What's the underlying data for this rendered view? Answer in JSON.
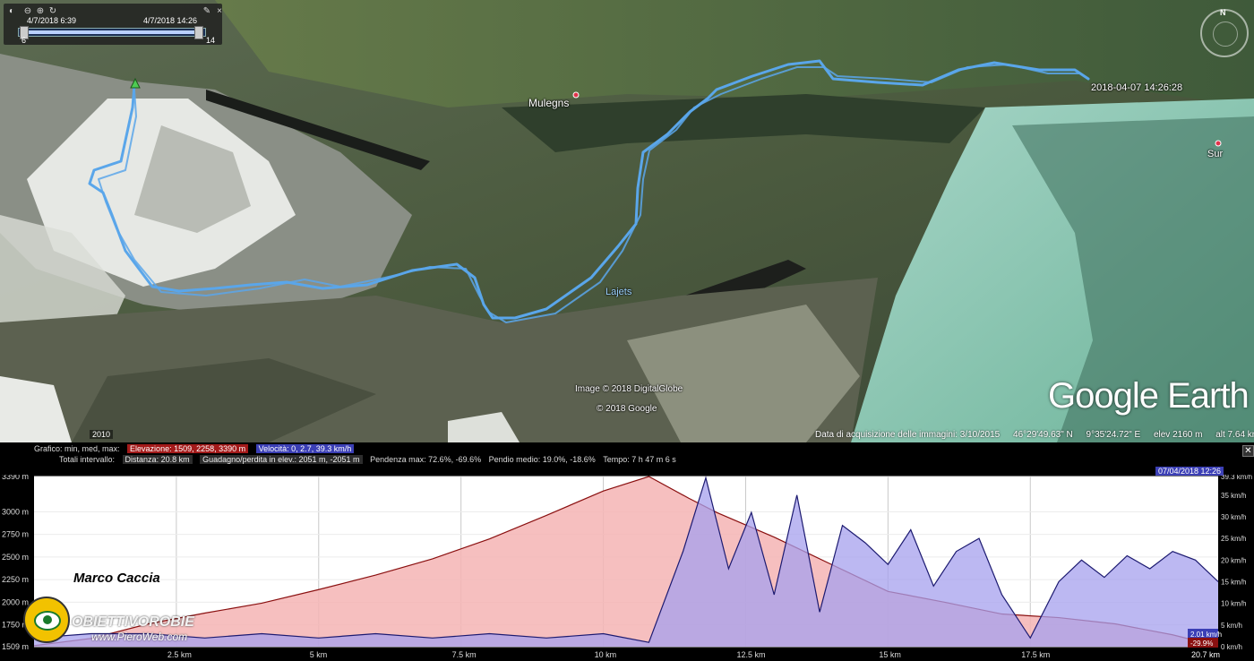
{
  "time_slider": {
    "start_label": "4/7/2018   6:39",
    "end_label": "4/7/2018  14:26",
    "min_tick": "6",
    "max_tick": "14"
  },
  "map": {
    "place_labels": [
      "Mulegns",
      "Lajets",
      "Sur"
    ],
    "track_end_label": "2018-04-07 14:26:28",
    "image_credits": [
      "Image © 2018 DigitalGlobe",
      "© 2018 Google"
    ],
    "logo": "Google Earth",
    "compass_n": "N",
    "year_badge": "2010",
    "track_color": "#5aa6ea"
  },
  "status_bar": {
    "acquisition": "Data di acquisizione delle immagini: 3/10/2015",
    "lat": "46°29'49.63\" N",
    "lon": "9°35'24.72\" E",
    "elev": "elev  2160 m",
    "alt": "alt   7.64 km"
  },
  "profile": {
    "stats_label_1": "Grafico: min, med, max:",
    "elevation_stats": "Elevazione: 1509, 2258, 3390 m",
    "speed_stats": "Velocità: 0, 2.7, 39.3 km/h",
    "stats_label_2": "Totali intervallo:",
    "distance": "Distanza: 20.8 km",
    "gain_loss": "Guadagno/perdita in elev.: 2051 m, -2051 m",
    "slope_max": "Pendenza max: 72.6%, -69.6%",
    "slope_avg": "Pendio medio: 19.0%, -18.6%",
    "time": "Tempo: 7 h 47 m 6 s",
    "date_flag": "07/04/2018 12:26",
    "close_icon": "close-icon"
  },
  "chart_data": {
    "type": "area",
    "x_ticks": [
      "2.5 km",
      "5 km",
      "7.5 km",
      "10 km",
      "12.5 km",
      "15 km",
      "17.5 km",
      "20.7 km"
    ],
    "y_left_ticks": [
      "3390 m",
      "3000 m",
      "2750 m",
      "2500 m",
      "2250 m",
      "2000 m",
      "1750 m",
      "1509 m"
    ],
    "y_right_ticks": [
      "39.3 km/h",
      "35 km/h",
      "30 km/h",
      "25 km/h",
      "20 km/h",
      "15 km/h",
      "10 km/h",
      "5 km/h",
      "0 km/h"
    ],
    "xlim": [
      0,
      20.8
    ],
    "ylim_elev": [
      1509,
      3390
    ],
    "ylim_speed": [
      0,
      39.3
    ],
    "elevation": {
      "name": "Elevazione",
      "x": [
        0,
        1,
        2,
        3,
        4,
        5,
        6,
        7,
        8,
        9,
        10,
        10.8,
        11.5,
        12,
        13,
        14,
        15,
        16,
        17,
        18,
        19,
        20,
        20.8
      ],
      "y": [
        1520,
        1600,
        1760,
        1880,
        1990,
        2140,
        2300,
        2480,
        2700,
        2960,
        3230,
        3390,
        3150,
        2990,
        2720,
        2420,
        2120,
        2000,
        1870,
        1830,
        1760,
        1640,
        1514
      ]
    },
    "speed": {
      "name": "Velocità",
      "x": [
        0,
        1,
        2,
        3,
        4,
        5,
        6,
        7,
        8,
        9,
        10,
        10.8,
        11.4,
        11.8,
        12.2,
        12.6,
        13.0,
        13.4,
        13.8,
        14.2,
        14.6,
        15.0,
        15.4,
        15.8,
        16.2,
        16.6,
        17.0,
        17.5,
        18.0,
        18.4,
        18.8,
        19.2,
        19.6,
        20.0,
        20.4,
        20.8
      ],
      "y": [
        2,
        3,
        3,
        2,
        3,
        2,
        3,
        2,
        3,
        2,
        3,
        1,
        22,
        39,
        18,
        31,
        12,
        35,
        8,
        28,
        24,
        19,
        27,
        14,
        22,
        25,
        12,
        2,
        15,
        20,
        16,
        21,
        18,
        22,
        20,
        15
      ]
    },
    "current": {
      "elevation": "1514 m",
      "speed": "2.01 km/h",
      "slope": "-29.9%",
      "distance": "20.7 km"
    },
    "colors": {
      "elev_fill": "#f4b4b4",
      "elev_line": "#8a1010",
      "speed_fill": "#a6a0ee",
      "speed_line": "#1c1a70"
    }
  },
  "watermark": {
    "author": "Marco Caccia",
    "name": "OBIETTIVOROBIE",
    "web": "www.PieroWeb.com"
  }
}
